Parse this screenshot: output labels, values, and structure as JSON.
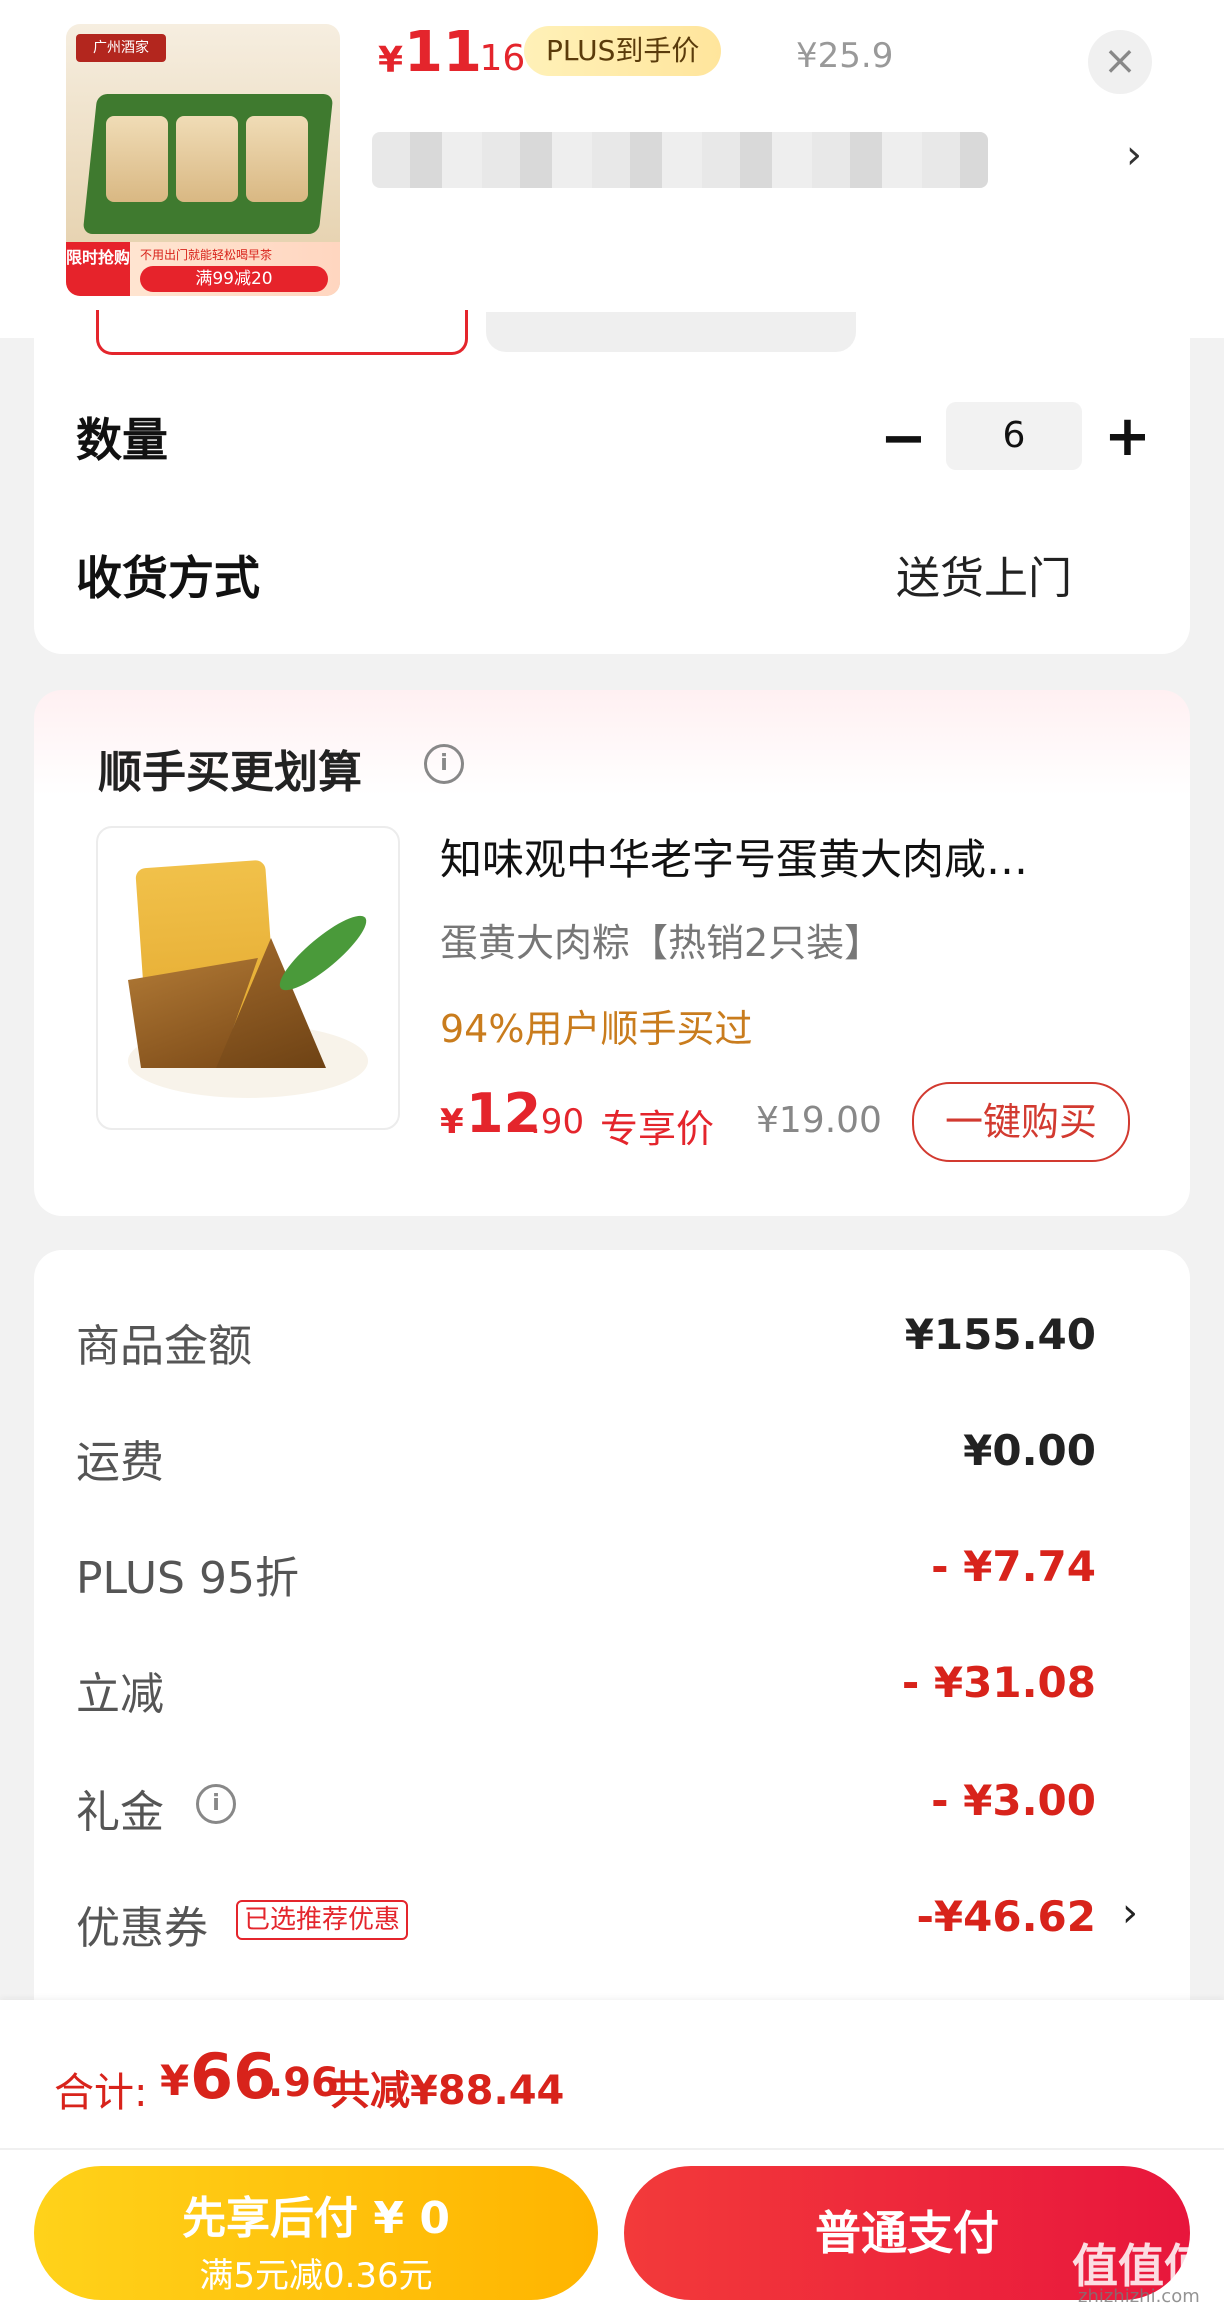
{
  "header": {
    "thumb_logo": "广州酒家",
    "thumb_promo_tag": "限时抢购",
    "thumb_promo_sub": "不用出门就能轻松喝早茶",
    "thumb_promo_bar": "满99减20",
    "price_currency": "¥",
    "price_integer": "11",
    "price_decimal": ".16",
    "plus_badge": "PLUS到手价",
    "original_price": "¥25.9",
    "close_icon": "×",
    "chevron": "›"
  },
  "options": {
    "quantity_label": "数量",
    "quantity_minus": "−",
    "quantity_value": "6",
    "quantity_plus": "+",
    "delivery_label": "收货方式",
    "delivery_value": "送货上门"
  },
  "bundle": {
    "title": "顺手买更划算",
    "info_icon": "i",
    "product_name": "知味观中华老字号蛋黄大肉咸…",
    "product_spec": "蛋黄大肉粽【热销2只装】",
    "bought_ratio": "94%用户顺手买过",
    "price_currency": "¥",
    "price_integer": "12",
    "price_decimal": ".90",
    "price_tag": "专享价",
    "original_price": "¥19.00",
    "buy_button": "一键购买"
  },
  "summary": {
    "rows": [
      {
        "label": "商品金额",
        "value": "¥155.40"
      },
      {
        "label": "运费",
        "value": "¥0.00"
      },
      {
        "label": "PLUS 95折",
        "value": "- ¥7.74"
      },
      {
        "label": "立减",
        "value": "- ¥31.08"
      },
      {
        "label": "礼金",
        "value": "- ¥3.00"
      },
      {
        "label": "优惠券",
        "value": "-¥46.62"
      }
    ],
    "gift_info_icon": "i",
    "coupon_badge": "已选推荐优惠",
    "coupon_chevron": "›"
  },
  "footer": {
    "total_label": "合计:",
    "total_currency": "¥",
    "total_integer": "66",
    "total_decimal": ".96",
    "total_saved": "共减¥88.44",
    "pay_later_line1": "先享后付 ¥ 0",
    "pay_later_line2": "满5元减0.36元",
    "pay_normal": "普通支付",
    "watermark": "值值值",
    "watermark_sub": "zhizhizhi.com"
  },
  "colors": {
    "accent_red": "#e4252c",
    "plus_gold": "#ffe59c",
    "pay_later_yellow": "#ffb400",
    "bought_orange": "#c97c1d"
  }
}
